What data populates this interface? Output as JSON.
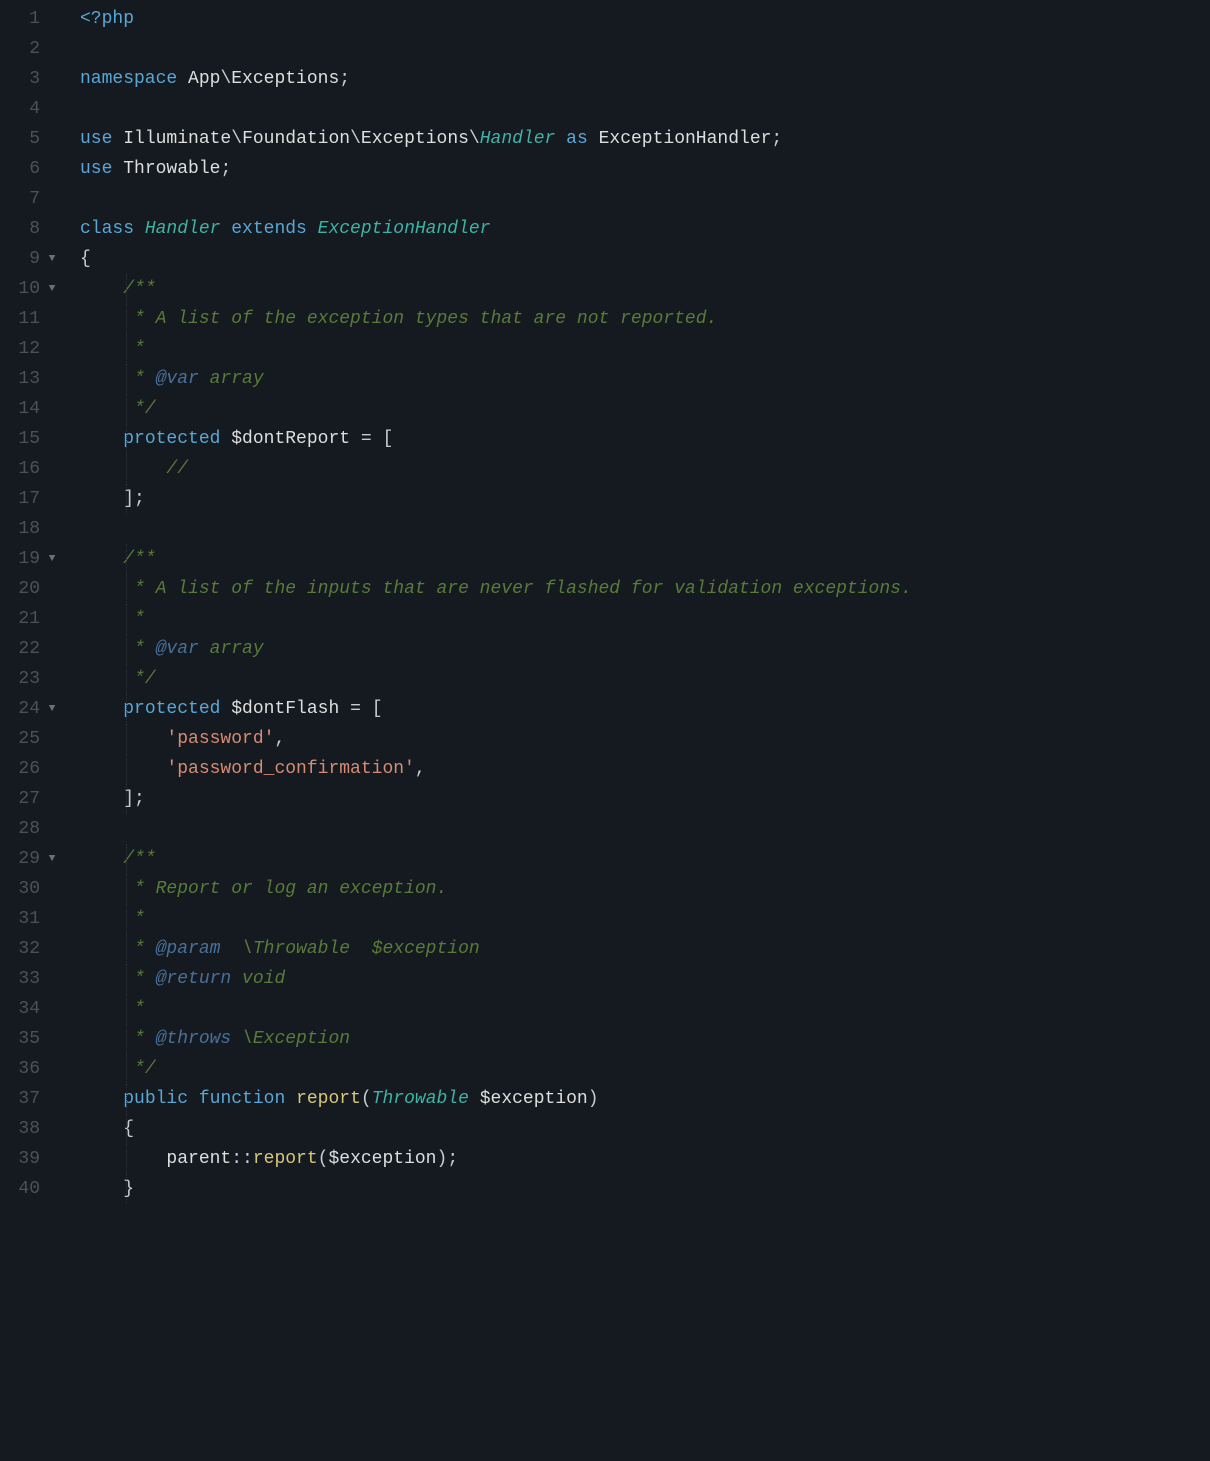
{
  "colors": {
    "background": "#141a1f",
    "gutter": "#4b5158",
    "keyword": "#5aa6d6",
    "type": "#3fb2a6",
    "comment": "#5a7a3a",
    "doctag": "#49709a",
    "string": "#d88b74",
    "function": "#d7c87a",
    "default": "#c8ccd0"
  },
  "foldMarker": "▼",
  "lines": [
    {
      "n": 1,
      "fold": false,
      "tokens": [
        [
          "tk-tag",
          "<?php"
        ]
      ]
    },
    {
      "n": 2,
      "fold": false,
      "tokens": []
    },
    {
      "n": 3,
      "fold": false,
      "tokens": [
        [
          "tk-kw",
          "namespace "
        ],
        [
          "tk-ns",
          "App"
        ],
        [
          "tk-punc",
          "\\"
        ],
        [
          "tk-ns",
          "Exceptions"
        ],
        [
          "tk-punc",
          ";"
        ]
      ]
    },
    {
      "n": 4,
      "fold": false,
      "tokens": []
    },
    {
      "n": 5,
      "fold": false,
      "tokens": [
        [
          "tk-kw",
          "use "
        ],
        [
          "tk-ns",
          "Illuminate"
        ],
        [
          "tk-punc",
          "\\"
        ],
        [
          "tk-ns",
          "Foundation"
        ],
        [
          "tk-punc",
          "\\"
        ],
        [
          "tk-ns",
          "Exceptions"
        ],
        [
          "tk-punc",
          "\\"
        ],
        [
          "tk-type",
          "Handler"
        ],
        [
          "tk-kw",
          " as "
        ],
        [
          "tk-ns",
          "ExceptionHandler"
        ],
        [
          "tk-punc",
          ";"
        ]
      ]
    },
    {
      "n": 6,
      "fold": false,
      "tokens": [
        [
          "tk-kw",
          "use "
        ],
        [
          "tk-ns",
          "Throwable"
        ],
        [
          "tk-punc",
          ";"
        ]
      ]
    },
    {
      "n": 7,
      "fold": false,
      "tokens": []
    },
    {
      "n": 8,
      "fold": false,
      "tokens": [
        [
          "tk-kw",
          "class "
        ],
        [
          "tk-type",
          "Handler"
        ],
        [
          "tk-kw",
          " extends "
        ],
        [
          "tk-type",
          "ExceptionHandler"
        ]
      ]
    },
    {
      "n": 9,
      "fold": true,
      "tokens": [
        [
          "tk-punc",
          "{"
        ]
      ]
    },
    {
      "n": 10,
      "fold": true,
      "indent": 1,
      "tokens": [
        [
          "tk-comm",
          "/**"
        ]
      ]
    },
    {
      "n": 11,
      "fold": false,
      "indent": 1,
      "tokens": [
        [
          "tk-comm",
          " * A list of the exception types that are not reported."
        ]
      ]
    },
    {
      "n": 12,
      "fold": false,
      "indent": 1,
      "tokens": [
        [
          "tk-comm",
          " *"
        ]
      ]
    },
    {
      "n": 13,
      "fold": false,
      "indent": 1,
      "tokens": [
        [
          "tk-comm",
          " * "
        ],
        [
          "tk-commtag",
          "@var"
        ],
        [
          "tk-comm",
          " array"
        ]
      ]
    },
    {
      "n": 14,
      "fold": false,
      "indent": 1,
      "tokens": [
        [
          "tk-comm",
          " */"
        ]
      ]
    },
    {
      "n": 15,
      "fold": false,
      "indent": 1,
      "tokens": [
        [
          "tk-kw",
          "protected "
        ],
        [
          "tk-var",
          "$dontReport"
        ],
        [
          "tk-op",
          " = "
        ],
        [
          "tk-punc",
          "["
        ]
      ]
    },
    {
      "n": 16,
      "fold": false,
      "indent": 2,
      "tokens": [
        [
          "tk-comm",
          "//"
        ]
      ]
    },
    {
      "n": 17,
      "fold": false,
      "indent": 1,
      "tokens": [
        [
          "tk-punc",
          "];"
        ]
      ]
    },
    {
      "n": 18,
      "fold": false,
      "tokens": []
    },
    {
      "n": 19,
      "fold": true,
      "indent": 1,
      "tokens": [
        [
          "tk-comm",
          "/**"
        ]
      ]
    },
    {
      "n": 20,
      "fold": false,
      "indent": 1,
      "tokens": [
        [
          "tk-comm",
          " * A list of the inputs that are never flashed for validation exceptions."
        ]
      ]
    },
    {
      "n": 21,
      "fold": false,
      "indent": 1,
      "tokens": [
        [
          "tk-comm",
          " *"
        ]
      ]
    },
    {
      "n": 22,
      "fold": false,
      "indent": 1,
      "tokens": [
        [
          "tk-comm",
          " * "
        ],
        [
          "tk-commtag",
          "@var"
        ],
        [
          "tk-comm",
          " array"
        ]
      ]
    },
    {
      "n": 23,
      "fold": false,
      "indent": 1,
      "tokens": [
        [
          "tk-comm",
          " */"
        ]
      ]
    },
    {
      "n": 24,
      "fold": true,
      "indent": 1,
      "tokens": [
        [
          "tk-kw",
          "protected "
        ],
        [
          "tk-var",
          "$dontFlash"
        ],
        [
          "tk-op",
          " = "
        ],
        [
          "tk-punc",
          "["
        ]
      ]
    },
    {
      "n": 25,
      "fold": false,
      "indent": 2,
      "tokens": [
        [
          "tk-str",
          "'password'"
        ],
        [
          "tk-punc",
          ","
        ]
      ]
    },
    {
      "n": 26,
      "fold": false,
      "indent": 2,
      "tokens": [
        [
          "tk-str",
          "'password_confirmation'"
        ],
        [
          "tk-punc",
          ","
        ]
      ]
    },
    {
      "n": 27,
      "fold": false,
      "indent": 1,
      "tokens": [
        [
          "tk-punc",
          "];"
        ]
      ]
    },
    {
      "n": 28,
      "fold": false,
      "tokens": []
    },
    {
      "n": 29,
      "fold": true,
      "indent": 1,
      "tokens": [
        [
          "tk-comm",
          "/**"
        ]
      ]
    },
    {
      "n": 30,
      "fold": false,
      "indent": 1,
      "tokens": [
        [
          "tk-comm",
          " * Report or log an exception."
        ]
      ]
    },
    {
      "n": 31,
      "fold": false,
      "indent": 1,
      "tokens": [
        [
          "tk-comm",
          " *"
        ]
      ]
    },
    {
      "n": 32,
      "fold": false,
      "indent": 1,
      "tokens": [
        [
          "tk-comm",
          " * "
        ],
        [
          "tk-commtag",
          "@param"
        ],
        [
          "tk-comm",
          "  \\Throwable  $exception"
        ]
      ]
    },
    {
      "n": 33,
      "fold": false,
      "indent": 1,
      "tokens": [
        [
          "tk-comm",
          " * "
        ],
        [
          "tk-commtag",
          "@return"
        ],
        [
          "tk-comm",
          " void"
        ]
      ]
    },
    {
      "n": 34,
      "fold": false,
      "indent": 1,
      "tokens": [
        [
          "tk-comm",
          " *"
        ]
      ]
    },
    {
      "n": 35,
      "fold": false,
      "indent": 1,
      "tokens": [
        [
          "tk-comm",
          " * "
        ],
        [
          "tk-commtag",
          "@throws"
        ],
        [
          "tk-comm",
          " \\Exception"
        ]
      ]
    },
    {
      "n": 36,
      "fold": false,
      "indent": 1,
      "tokens": [
        [
          "tk-comm",
          " */"
        ]
      ]
    },
    {
      "n": 37,
      "fold": false,
      "indent": 1,
      "tokens": [
        [
          "tk-kw",
          "public "
        ],
        [
          "tk-kw",
          "function "
        ],
        [
          "tk-fn",
          "report"
        ],
        [
          "tk-punc",
          "("
        ],
        [
          "tk-type",
          "Throwable"
        ],
        [
          "tk-punc",
          " "
        ],
        [
          "tk-var",
          "$exception"
        ],
        [
          "tk-punc",
          ")"
        ]
      ]
    },
    {
      "n": 38,
      "fold": false,
      "indent": 1,
      "tokens": [
        [
          "tk-punc",
          "{"
        ]
      ]
    },
    {
      "n": 39,
      "fold": false,
      "indent": 2,
      "tokens": [
        [
          "tk-ns",
          "parent"
        ],
        [
          "tk-punc",
          "::"
        ],
        [
          "tk-fn",
          "report"
        ],
        [
          "tk-punc",
          "("
        ],
        [
          "tk-var",
          "$exception"
        ],
        [
          "tk-punc",
          ")"
        ],
        [
          "tk-punc",
          ";"
        ]
      ]
    },
    {
      "n": 40,
      "fold": false,
      "indent": 1,
      "tokens": [
        [
          "tk-punc",
          "}"
        ]
      ]
    }
  ]
}
